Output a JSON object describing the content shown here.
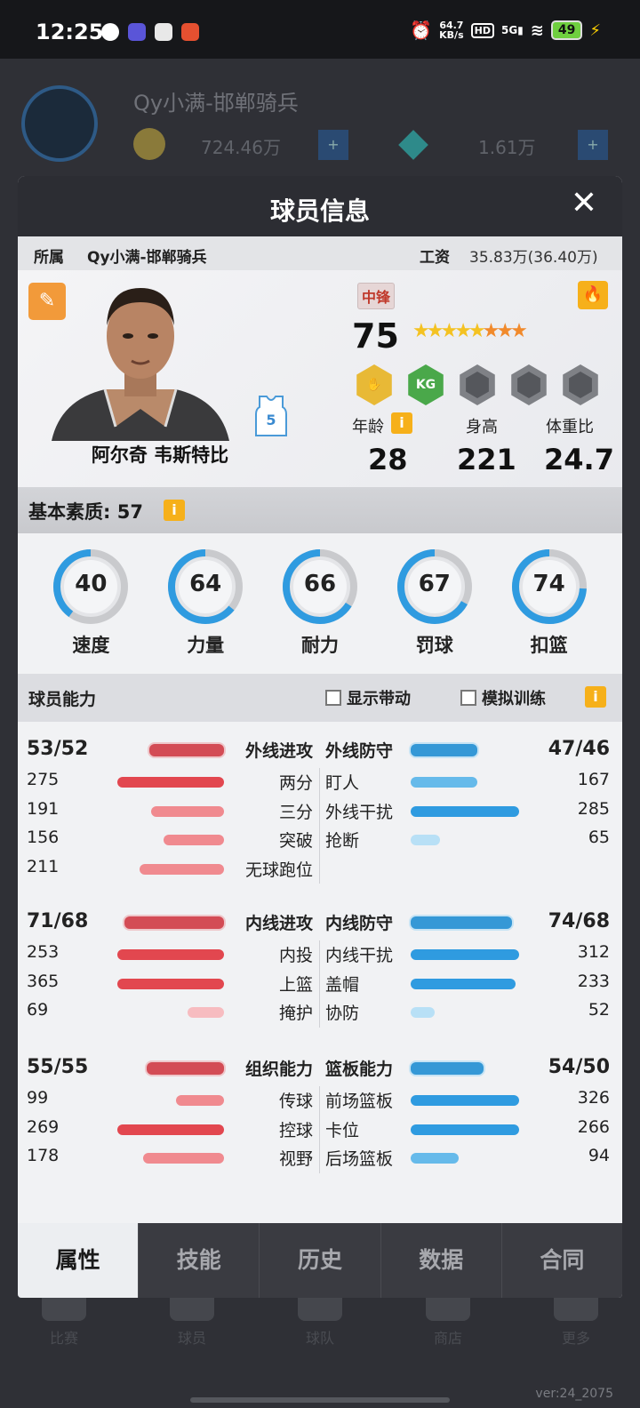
{
  "status_bar": {
    "time": "12:25",
    "net_speed_value": "64.7",
    "net_speed_unit": "KB/s",
    "hd": "HD",
    "signal": "5G",
    "battery": "49"
  },
  "background_app": {
    "team_name": "Qy小满-邯郸骑兵",
    "coins": "724.46万",
    "gems": "1.61万",
    "plus": "+",
    "tabs": [
      "比赛",
      "球员",
      "球队",
      "商店",
      "更多"
    ],
    "version": "ver:24_2075"
  },
  "modal": {
    "title": "球员信息",
    "close": "✕",
    "affiliation_label": "所属",
    "team": "Qy小满-邯郸骑兵",
    "salary_label": "工资",
    "salary_value": "35.83万(36.40万)"
  },
  "player": {
    "name": "阿尔奇 韦斯特比",
    "position": "中锋",
    "rating": "75",
    "stars_total": 8,
    "stars_gold": 5,
    "jersey_number": "5",
    "badges": [
      "gold",
      "KG",
      "locked",
      "locked",
      "locked"
    ],
    "badge_kg": "KG",
    "age_label": "年龄",
    "height_label": "身高",
    "weight_label": "体重比",
    "age": "28",
    "height": "221",
    "weight": "24.7",
    "info": "i"
  },
  "basic": {
    "label": "基本素质: 57",
    "attributes": [
      {
        "label": "速度",
        "value": "40",
        "pct": 40
      },
      {
        "label": "力量",
        "value": "64",
        "pct": 64
      },
      {
        "label": "耐力",
        "value": "66",
        "pct": 66
      },
      {
        "label": "罚球",
        "value": "67",
        "pct": 67
      },
      {
        "label": "扣篮",
        "value": "74",
        "pct": 74
      }
    ]
  },
  "ability": {
    "label": "球员能力",
    "show_movement": "显示带动",
    "sim_training": "模拟训练",
    "groups": [
      {
        "left_head": {
          "name": "外线进攻",
          "value": "53/52",
          "pct": 0.62
        },
        "right_head": {
          "name": "外线防守",
          "value": "47/46",
          "pct": 0.55
        },
        "left": [
          {
            "name": "两分",
            "value": "275",
            "pct": 0.88
          },
          {
            "name": "三分",
            "value": "191",
            "pct": 0.6
          },
          {
            "name": "突破",
            "value": "156",
            "pct": 0.5
          },
          {
            "name": "无球跑位",
            "value": "211",
            "pct": 0.7
          }
        ],
        "right": [
          {
            "name": "盯人",
            "value": "167",
            "pct": 0.55
          },
          {
            "name": "外线干扰",
            "value": "285",
            "pct": 0.9
          },
          {
            "name": "抢断",
            "value": "65",
            "pct": 0.24
          }
        ]
      },
      {
        "left_head": {
          "name": "内线进攻",
          "value": "71/68",
          "pct": 0.82
        },
        "right_head": {
          "name": "内线防守",
          "value": "74/68",
          "pct": 0.84
        },
        "left": [
          {
            "name": "内投",
            "value": "253",
            "pct": 0.88
          },
          {
            "name": "上篮",
            "value": "365",
            "pct": 0.88
          },
          {
            "name": "掩护",
            "value": "69",
            "pct": 0.3
          }
        ],
        "right": [
          {
            "name": "内线干扰",
            "value": "312",
            "pct": 0.9
          },
          {
            "name": "盖帽",
            "value": "233",
            "pct": 0.87
          },
          {
            "name": "协防",
            "value": "52",
            "pct": 0.2
          }
        ]
      },
      {
        "left_head": {
          "name": "组织能力",
          "value": "55/55",
          "pct": 0.64
        },
        "right_head": {
          "name": "篮板能力",
          "value": "54/50",
          "pct": 0.6
        },
        "left": [
          {
            "name": "传球",
            "value": "99",
            "pct": 0.4
          },
          {
            "name": "控球",
            "value": "269",
            "pct": 0.88
          },
          {
            "name": "视野",
            "value": "178",
            "pct": 0.67
          }
        ],
        "right": [
          {
            "name": "前场篮板",
            "value": "326",
            "pct": 0.9
          },
          {
            "name": "卡位",
            "value": "266",
            "pct": 0.9
          },
          {
            "name": "后场篮板",
            "value": "94",
            "pct": 0.4
          }
        ]
      }
    ]
  },
  "tabs": [
    "属性",
    "技能",
    "历史",
    "数据",
    "合同"
  ],
  "active_tab": 0,
  "colors": {
    "accent": "#f6b01a",
    "red": "#e2474f",
    "blue": "#2f9be0",
    "header": "#2c2d33"
  }
}
